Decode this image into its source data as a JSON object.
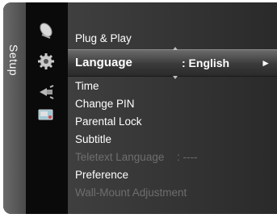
{
  "sidebar": {
    "label": "Setup"
  },
  "icons": [
    "satellite-dish-icon",
    "gear-icon",
    "input-plug-icon",
    "remote-control-icon"
  ],
  "menu": {
    "items": [
      {
        "label": "Plug & Play",
        "value": "",
        "enabled": true
      },
      {
        "label": "Language",
        "value": ": English",
        "enabled": true,
        "selected": true
      },
      {
        "label": "Time",
        "value": "",
        "enabled": true
      },
      {
        "label": "Change PIN",
        "value": "",
        "enabled": true
      },
      {
        "label": "Parental Lock",
        "value": "",
        "enabled": true
      },
      {
        "label": "Subtitle",
        "value": "",
        "enabled": true
      },
      {
        "label": "Teletext Language",
        "value": ": ----",
        "enabled": false
      },
      {
        "label": "Preference",
        "value": "",
        "enabled": true
      },
      {
        "label": "Wall-Mount Adjustment",
        "value": "",
        "enabled": false
      }
    ],
    "arrow": "►"
  },
  "colors": {
    "text": "#ffffff",
    "disabled": "#6e6e6e",
    "highlight": "#5a5a5a"
  }
}
